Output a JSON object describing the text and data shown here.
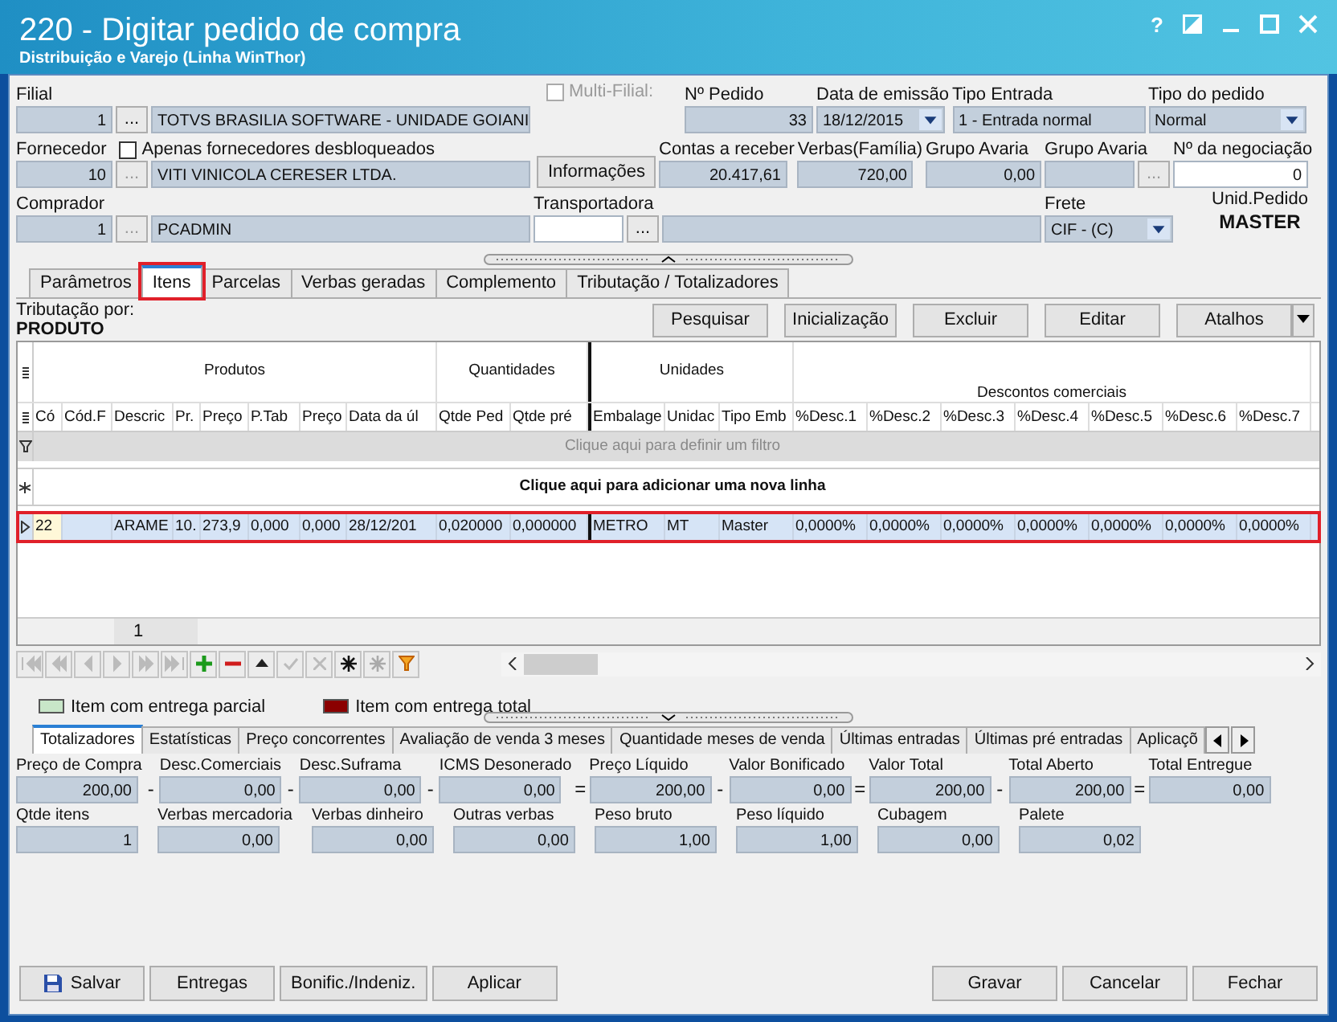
{
  "window": {
    "title": "220 - Digitar pedido de compra",
    "subtitle": "Distribuição e Varejo (Linha WinThor)",
    "help": "?"
  },
  "header": {
    "filial": {
      "label": "Filial",
      "code": "1",
      "button": "...",
      "name": "TOTVS BRASILIA SOFTWARE - UNIDADE GOIANI"
    },
    "multi_filial": {
      "label": "Multi-Filial:",
      "checked": false,
      "disabled": true
    },
    "numero_pedido": {
      "label": "Nº Pedido",
      "value": "33"
    },
    "data_emissao": {
      "label": "Data de emissão",
      "value": "18/12/2015"
    },
    "tipo_entrada": {
      "label": "Tipo Entrada",
      "value": "1 - Entrada normal"
    },
    "tipo_pedido": {
      "label": "Tipo do pedido",
      "value": "Normal"
    },
    "fornecedor": {
      "label": "Fornecedor",
      "code": "10",
      "button": "...",
      "name": "VITI VINICOLA CERESER LTDA."
    },
    "apenas_desbloqueados": {
      "label": "Apenas fornecedores desbloqueados",
      "checked": false
    },
    "informacoes_button": "Informações",
    "contas_receber": {
      "label": "Contas a receber",
      "value": "20.417,61"
    },
    "verbas_familia": {
      "label": "Verbas(Família)",
      "value": "720,00"
    },
    "grupo_avaria_1": {
      "label": "Grupo Avaria",
      "value": "0,00"
    },
    "grupo_avaria_2": {
      "label": "Grupo Avaria",
      "button": "..."
    },
    "negociacao": {
      "label": "Nº da negociação",
      "value": "0"
    },
    "comprador": {
      "label": "Comprador",
      "code": "1",
      "button": "...",
      "name": "PCADMIN"
    },
    "transportadora": {
      "label": "Transportadora",
      "button": "..."
    },
    "frete": {
      "label": "Frete",
      "value": "CIF - (C)"
    },
    "unid_pedido": {
      "label": "Unid.Pedido",
      "value": "MASTER"
    }
  },
  "tabs": [
    {
      "label": "Parâmetros",
      "selected": false,
      "highlighted": false
    },
    {
      "label": "Itens",
      "selected": true,
      "highlighted": true
    },
    {
      "label": "Parcelas",
      "selected": false,
      "highlighted": false
    },
    {
      "label": "Verbas geradas",
      "selected": false,
      "highlighted": false
    },
    {
      "label": "Complemento",
      "selected": false,
      "highlighted": false
    },
    {
      "label": "Tributação / Totalizadores",
      "selected": false,
      "highlighted": false
    }
  ],
  "toolbar": {
    "tributacao_label": "Tributação por:",
    "tributacao_value": "PRODUTO",
    "buttons": [
      "Pesquisar",
      "Inicialização",
      "Excluir",
      "Editar",
      "Atalhos"
    ]
  },
  "grid": {
    "column_groups": [
      {
        "label": "Produtos",
        "columns": [
          "Có",
          "Cód.F",
          "Descric",
          "Pr.",
          "Preço",
          "P.Tab",
          "Preço",
          "Data da úl"
        ]
      },
      {
        "label": "Quantidades",
        "columns": [
          "Qtde Ped",
          "Qtde pré"
        ]
      },
      {
        "label": "Unidades",
        "columns": [
          "Embalage",
          "Unidac",
          "Tipo Emb"
        ]
      },
      {
        "label": "Descontos comerciais",
        "columns": [
          "%Desc.1",
          "%Desc.2",
          "%Desc.3",
          "%Desc.4",
          "%Desc.5",
          "%Desc.6",
          "%Desc.7"
        ]
      }
    ],
    "filter_row": "Clique aqui para definir um filtro",
    "new_row": "Clique aqui para adicionar uma nova linha",
    "rows": [
      {
        "highlighted": true,
        "cells": [
          "22",
          null,
          "ARAME",
          "10.",
          "273,9",
          "0,000",
          "0,000",
          "28/12/201",
          "0,020000",
          "0,000000",
          "METRO",
          "MT",
          "Master",
          "0,0000%",
          "0,0000%",
          "0,0000%",
          "0,0000%",
          "0,0000%",
          "0,0000%",
          "0,0000%"
        ]
      }
    ],
    "footer_count": "1"
  },
  "legend": [
    {
      "label": "Item com entrega parcial",
      "color": "#c8e6c8"
    },
    {
      "label": "Item com entrega total",
      "color": "#8b0000"
    }
  ],
  "bottom_tabs": [
    {
      "label": "Totalizadores",
      "selected": true
    },
    {
      "label": "Estatísticas",
      "selected": false
    },
    {
      "label": "Preço concorrentes",
      "selected": false
    },
    {
      "label": "Avaliação de venda 3 meses",
      "selected": false
    },
    {
      "label": "Quantidade meses de venda",
      "selected": false
    },
    {
      "label": "Últimas entradas",
      "selected": false
    },
    {
      "label": "Últimas pré entradas",
      "selected": false
    },
    {
      "label": "Aplicaçõ",
      "selected": false
    }
  ],
  "totals": [
    {
      "label": "Preço de Compra",
      "value": "200,00",
      "operator": "-"
    },
    {
      "label": "Desc.Comerciais",
      "value": "0,00",
      "operator": "-"
    },
    {
      "label": "Desc.Suframa",
      "value": "0,00",
      "operator": "-"
    },
    {
      "label": "ICMS Desonerado",
      "value": "0,00",
      "operator": "="
    },
    {
      "label": "Preço Líquido",
      "value": "200,00",
      "operator": "-"
    },
    {
      "label": "Valor Bonificado",
      "value": "0,00",
      "operator": "="
    },
    {
      "label": "Valor Total",
      "value": "200,00",
      "operator": "-"
    },
    {
      "label": "Total Aberto",
      "value": "200,00",
      "operator": "="
    },
    {
      "label": "Total Entregue",
      "value": "0,00"
    }
  ],
  "totals_row2": [
    {
      "label": "Qtde itens",
      "value": "1"
    },
    {
      "label": "Verbas mercadoria",
      "value": "0,00"
    },
    {
      "label": "Verbas dinheiro",
      "value": "0,00"
    },
    {
      "label": "Outras verbas",
      "value": "0,00"
    },
    {
      "label": "Peso bruto",
      "value": "1,00"
    },
    {
      "label": "Peso líquido",
      "value": "1,00"
    },
    {
      "label": "Cubagem",
      "value": "0,00"
    },
    {
      "label": "Palete",
      "value": "0,02"
    }
  ],
  "buttons_left": [
    "Salvar",
    "Entregas",
    "Bonific./Indeniz.",
    "Aplicar"
  ],
  "buttons_right": [
    "Gravar",
    "Cancelar",
    "Fechar"
  ]
}
